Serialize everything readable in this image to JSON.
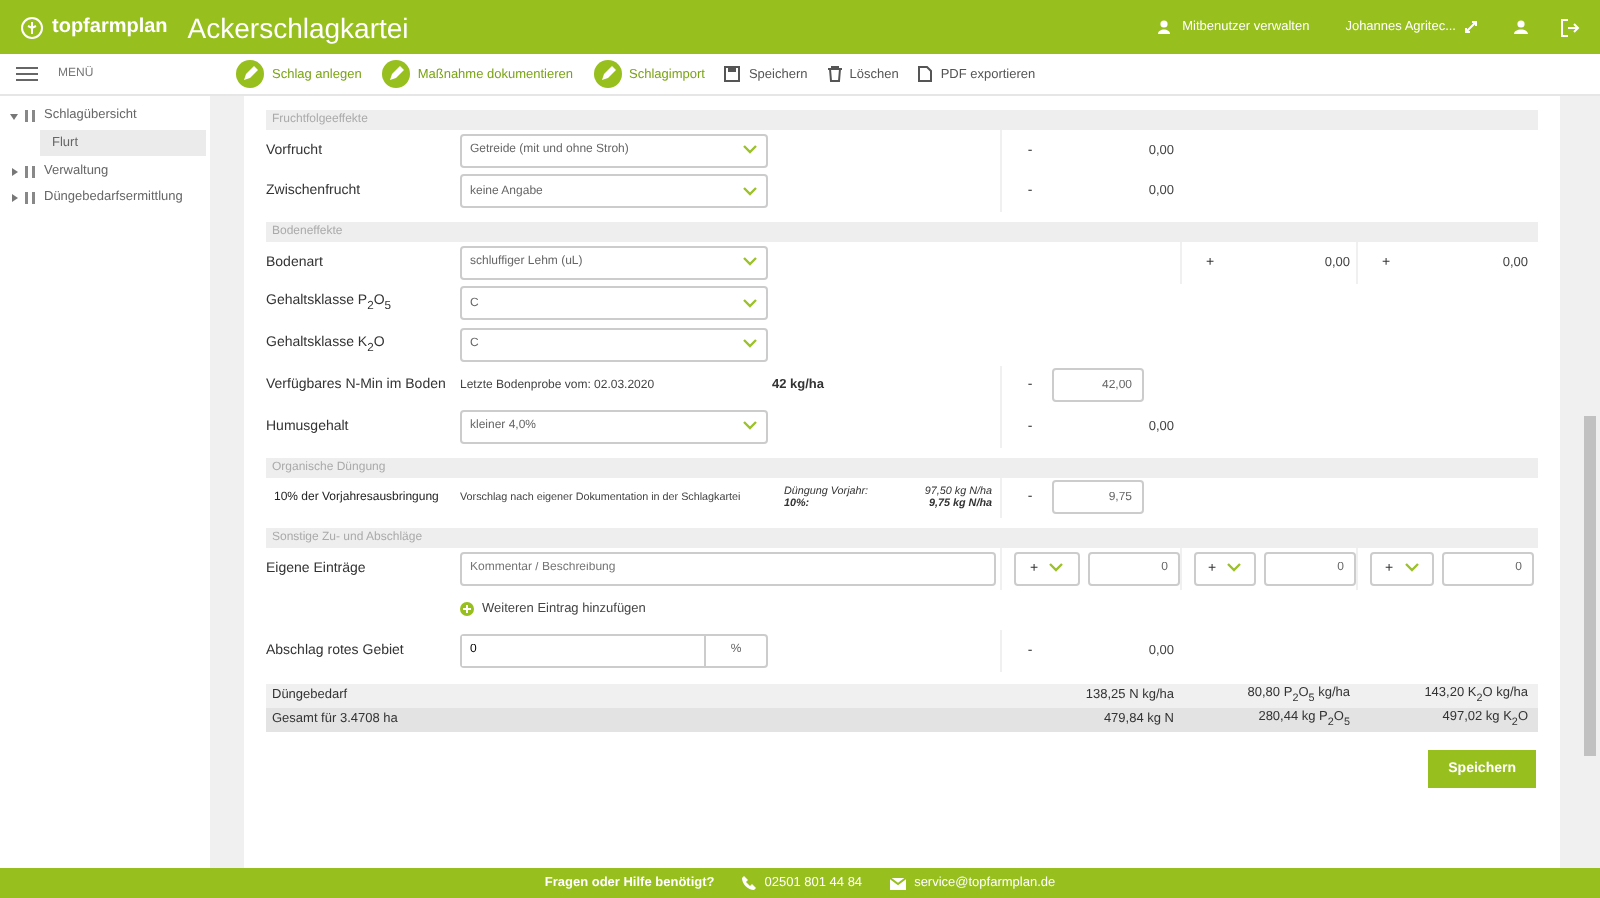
{
  "header": {
    "brand": "topfarmplan",
    "title": "Ackerschlagkartei",
    "co_users": "Mitbenutzer verwalten",
    "user": "Johannes Agritec..."
  },
  "toolbar": {
    "menu_label": "MENÜ",
    "actions": [
      {
        "kind": "circle",
        "label": "Schlag anlegen"
      },
      {
        "kind": "circle",
        "label": "Maßnahme dokumentieren"
      },
      {
        "kind": "circle",
        "label": "Schlagimport"
      },
      {
        "kind": "save",
        "label": "Speichern"
      },
      {
        "kind": "delete",
        "label": "Löschen"
      },
      {
        "kind": "pdf",
        "label": "PDF exportieren"
      }
    ]
  },
  "sidebar": {
    "items": [
      {
        "label": "Schlagübersicht",
        "expanded": true,
        "children": [
          {
            "label": "Flurt",
            "selected": true
          }
        ]
      },
      {
        "label": "Verwaltung",
        "expanded": false
      },
      {
        "label": "Düngebedarfsermittlung",
        "expanded": false
      }
    ]
  },
  "sections": [
    {
      "title": "Fruchtfolgeeffekte",
      "rows": [
        {
          "kind": "select",
          "label": "Vorfrucht",
          "value": "Getreide (mit und ohne Stroh)",
          "n": {
            "kind": "text",
            "sign": "-",
            "value": "0,00"
          }
        },
        {
          "kind": "select",
          "label": "Zwischenfrucht",
          "value": "keine Angabe",
          "n": {
            "kind": "text",
            "sign": "-",
            "value": "0,00"
          }
        }
      ]
    },
    {
      "title": "Bodeneffekte",
      "rows": [
        {
          "kind": "select",
          "label": "Bodenart",
          "value": "schluffiger Lehm (uL)",
          "p": {
            "kind": "text",
            "sign": "+",
            "value": "0,00"
          },
          "k": {
            "kind": "text",
            "sign": "+",
            "value": "0,00"
          }
        },
        {
          "kind": "select",
          "label": "Gehaltsklasse P$_{2}$O$_{5}$",
          "value": "C"
        },
        {
          "kind": "select",
          "label": "Gehaltsklasse K$_{2}$O",
          "value": "C"
        },
        {
          "kind": "info",
          "label": "Verfügbares N-Min im Boden",
          "value": "Letzte Bodenprobe vom: 02.03.2020",
          "note": "42 kg/ha",
          "n": {
            "kind": "input",
            "sign": "-",
            "value": "42,00"
          }
        },
        {
          "kind": "select",
          "label": "Humusgehalt",
          "value": "kleiner 4,0%",
          "n": {
            "kind": "text",
            "sign": "-",
            "value": "0,00"
          }
        }
      ]
    },
    {
      "title": "Organische Düngung",
      "rows": [
        {
          "kind": "organic",
          "label": "10% der Vorjahresausbringung",
          "value": "Vorschlag nach eigener Dokumentation in der Schlagkartei",
          "lines": [
            {
              "label": "Düngung Vorjahr:",
              "value": "97,50 kg N/ha"
            },
            {
              "label": "10%:",
              "value": "9,75 kg N/ha"
            }
          ],
          "n": {
            "kind": "input",
            "sign": "-",
            "value": "9,75"
          }
        }
      ]
    },
    {
      "title": "Sonstige Zu- und Abschläge",
      "rows": [
        {
          "kind": "comment",
          "label": "Eigene Einträge",
          "placeholder": "Kommentar / Beschreibung",
          "n": {
            "kind": "sign_input",
            "sign": "+",
            "value": "0"
          },
          "p": {
            "kind": "sign_input",
            "sign": "+",
            "value": "0"
          },
          "k": {
            "kind": "sign_input",
            "sign": "+",
            "value": "0"
          }
        },
        {
          "kind": "add",
          "value": "Weiteren Eintrag hinzufügen"
        },
        {
          "kind": "unit",
          "label": "Abschlag rotes Gebiet",
          "value": "0",
          "unit": "%",
          "n": {
            "kind": "text",
            "sign": "-",
            "value": "0,00"
          }
        }
      ]
    }
  ],
  "totals": [
    {
      "label": "Düngebedarf",
      "n": "138,25 N kg/ha",
      "p": "80,80 P$_{2}$O$_{5}$ kg/ha",
      "k": "143,20 K$_{2}$O kg/ha"
    },
    {
      "label": "Gesamt für 3.4708 ha",
      "n": "479,84 kg N",
      "p": "280,44 kg P$_{2}$O$_{5}$",
      "k": "497,02 kg K$_{2}$O"
    }
  ],
  "save_button": "Speichern",
  "footer": {
    "question": "Fragen oder Hilfe benötigt?",
    "phone": "02501 801 44 84",
    "email": "service@topfarmplan.de"
  }
}
